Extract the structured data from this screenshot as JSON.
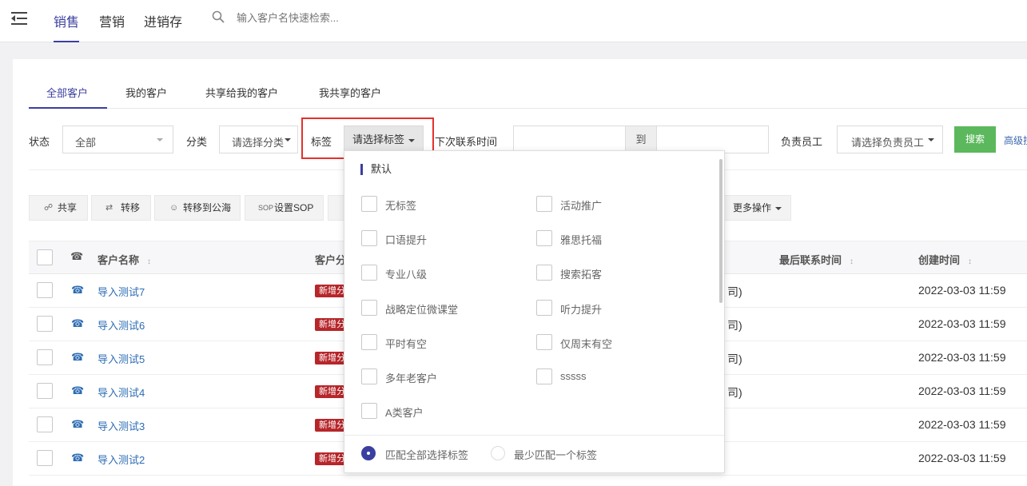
{
  "topnav": {
    "tabs": [
      {
        "label": "销售",
        "active": true
      },
      {
        "label": "营销"
      },
      {
        "label": "进销存"
      }
    ],
    "search_placeholder": "输入客户名快速检索..."
  },
  "subtabs": [
    {
      "label": "全部客户",
      "active": true
    },
    {
      "label": "我的客户"
    },
    {
      "label": "共享给我的客户"
    },
    {
      "label": "我共享的客户"
    }
  ],
  "filters": {
    "status_label": "状态",
    "status_value": "全部",
    "category_label": "分类",
    "category_value": "请选择分类",
    "tag_label": "标签",
    "tag_value": "请选择标签",
    "next_contact_label": "下次联系时间",
    "to_label": "到",
    "owner_label": "负责员工",
    "owner_value": "请选择负责员工",
    "search_button": "搜索",
    "advanced_link": "高级搜索"
  },
  "actions": {
    "share": "共享",
    "transfer": "转移",
    "to_public": "转移到公海",
    "set_sop": "设置SOP",
    "more": "更多操作"
  },
  "table": {
    "headers": {
      "name": "客户名称",
      "category": "客户分",
      "last_contact": "最后联系时间",
      "created": "创建时间"
    },
    "rows": [
      {
        "name": "导入测试7",
        "badge": "新增分类",
        "paren": "司)",
        "created": "2022-03-03 11:59"
      },
      {
        "name": "导入测试6",
        "badge": "新增分类",
        "paren": "司)",
        "created": "2022-03-03 11:59"
      },
      {
        "name": "导入测试5",
        "badge": "新增分类",
        "paren": "司)",
        "created": "2022-03-03 11:59"
      },
      {
        "name": "导入测试4",
        "badge": "新增分类",
        "paren": "司)",
        "created": "2022-03-03 11:59"
      },
      {
        "name": "导入测试3",
        "badge": "新增分类",
        "paren": "",
        "created": "2022-03-03 11:59"
      },
      {
        "name": "导入测试2",
        "badge": "新增分类",
        "paren": "",
        "created": "2022-03-03 11:59"
      }
    ]
  },
  "tag_dropdown": {
    "group_title": "默认",
    "options_left": [
      "无标签",
      "口语提升",
      "专业八级",
      "战略定位微课堂",
      "平时有空",
      "多年老客户",
      "A类客户"
    ],
    "options_right": [
      "活动推广",
      "雅思托福",
      "搜索拓客",
      "听力提升",
      "仅周末有空",
      "sssss"
    ],
    "match_all": "匹配全部选择标签",
    "match_one": "最少匹配一个标签"
  }
}
